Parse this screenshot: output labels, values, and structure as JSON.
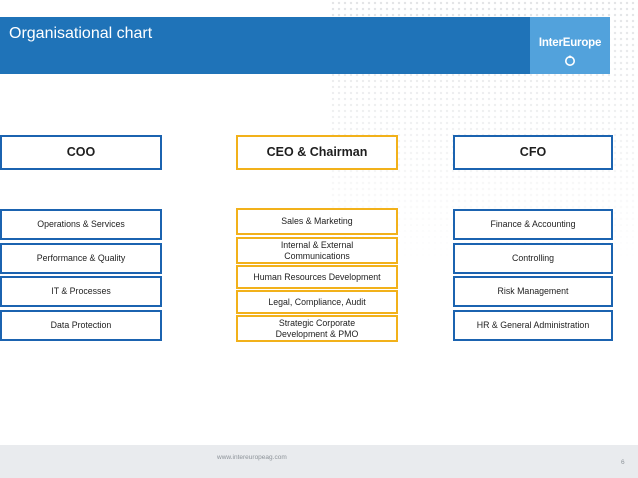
{
  "slide": {
    "title": "Organisational chart",
    "logo_text": "InterEurope",
    "footer_url": "www.intereuropeag.com",
    "page_number": "6"
  },
  "colors": {
    "header_blue": "#1f73b8",
    "logo_blue": "#52a2dc",
    "box_border_blue": "#1b63b0",
    "box_border_gold": "#f2b11a",
    "footer_band": "#e9ebee"
  },
  "org_chart": {
    "coo": {
      "head": "COO",
      "items": [
        "Operations & Services",
        "Performance & Quality",
        "IT & Processes",
        "Data Protection"
      ]
    },
    "ceo": {
      "head": "CEO & Chairman",
      "items": [
        "Sales & Marketing",
        "Internal & External Communications",
        "Human Resources Development",
        "Legal, Compliance, Audit",
        "Strategic Corporate Development & PMO"
      ]
    },
    "cfo": {
      "head": "CFO",
      "items": [
        "Finance & Accounting",
        "Controlling",
        "Risk Management",
        "HR & General Administration"
      ]
    }
  }
}
